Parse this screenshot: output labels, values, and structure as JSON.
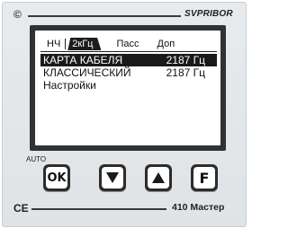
{
  "device": {
    "brand_logo": "©",
    "brand": "SVPRIBOR",
    "model": "410 Мастер",
    "ce_mark": "CE"
  },
  "tabs": [
    {
      "label": "НЧ",
      "active": false
    },
    {
      "label": "2кГц",
      "active": true
    },
    {
      "label": "Пасс",
      "active": false
    },
    {
      "label": "Доп",
      "active": false
    }
  ],
  "menu": [
    {
      "label": "КАРТА КАБЕЛЯ",
      "value": "2187 Гц",
      "selected": true
    },
    {
      "label": "КЛАССИЧЕСКИЙ",
      "value": "2187 Гц",
      "selected": false
    },
    {
      "label": "Настройки",
      "value": "",
      "selected": false
    }
  ],
  "buttons": {
    "auto_label": "AUTO",
    "ok_label": "OK",
    "f_label": "F"
  },
  "icons": {
    "down": "down-triangle-icon",
    "up": "up-triangle-icon"
  }
}
